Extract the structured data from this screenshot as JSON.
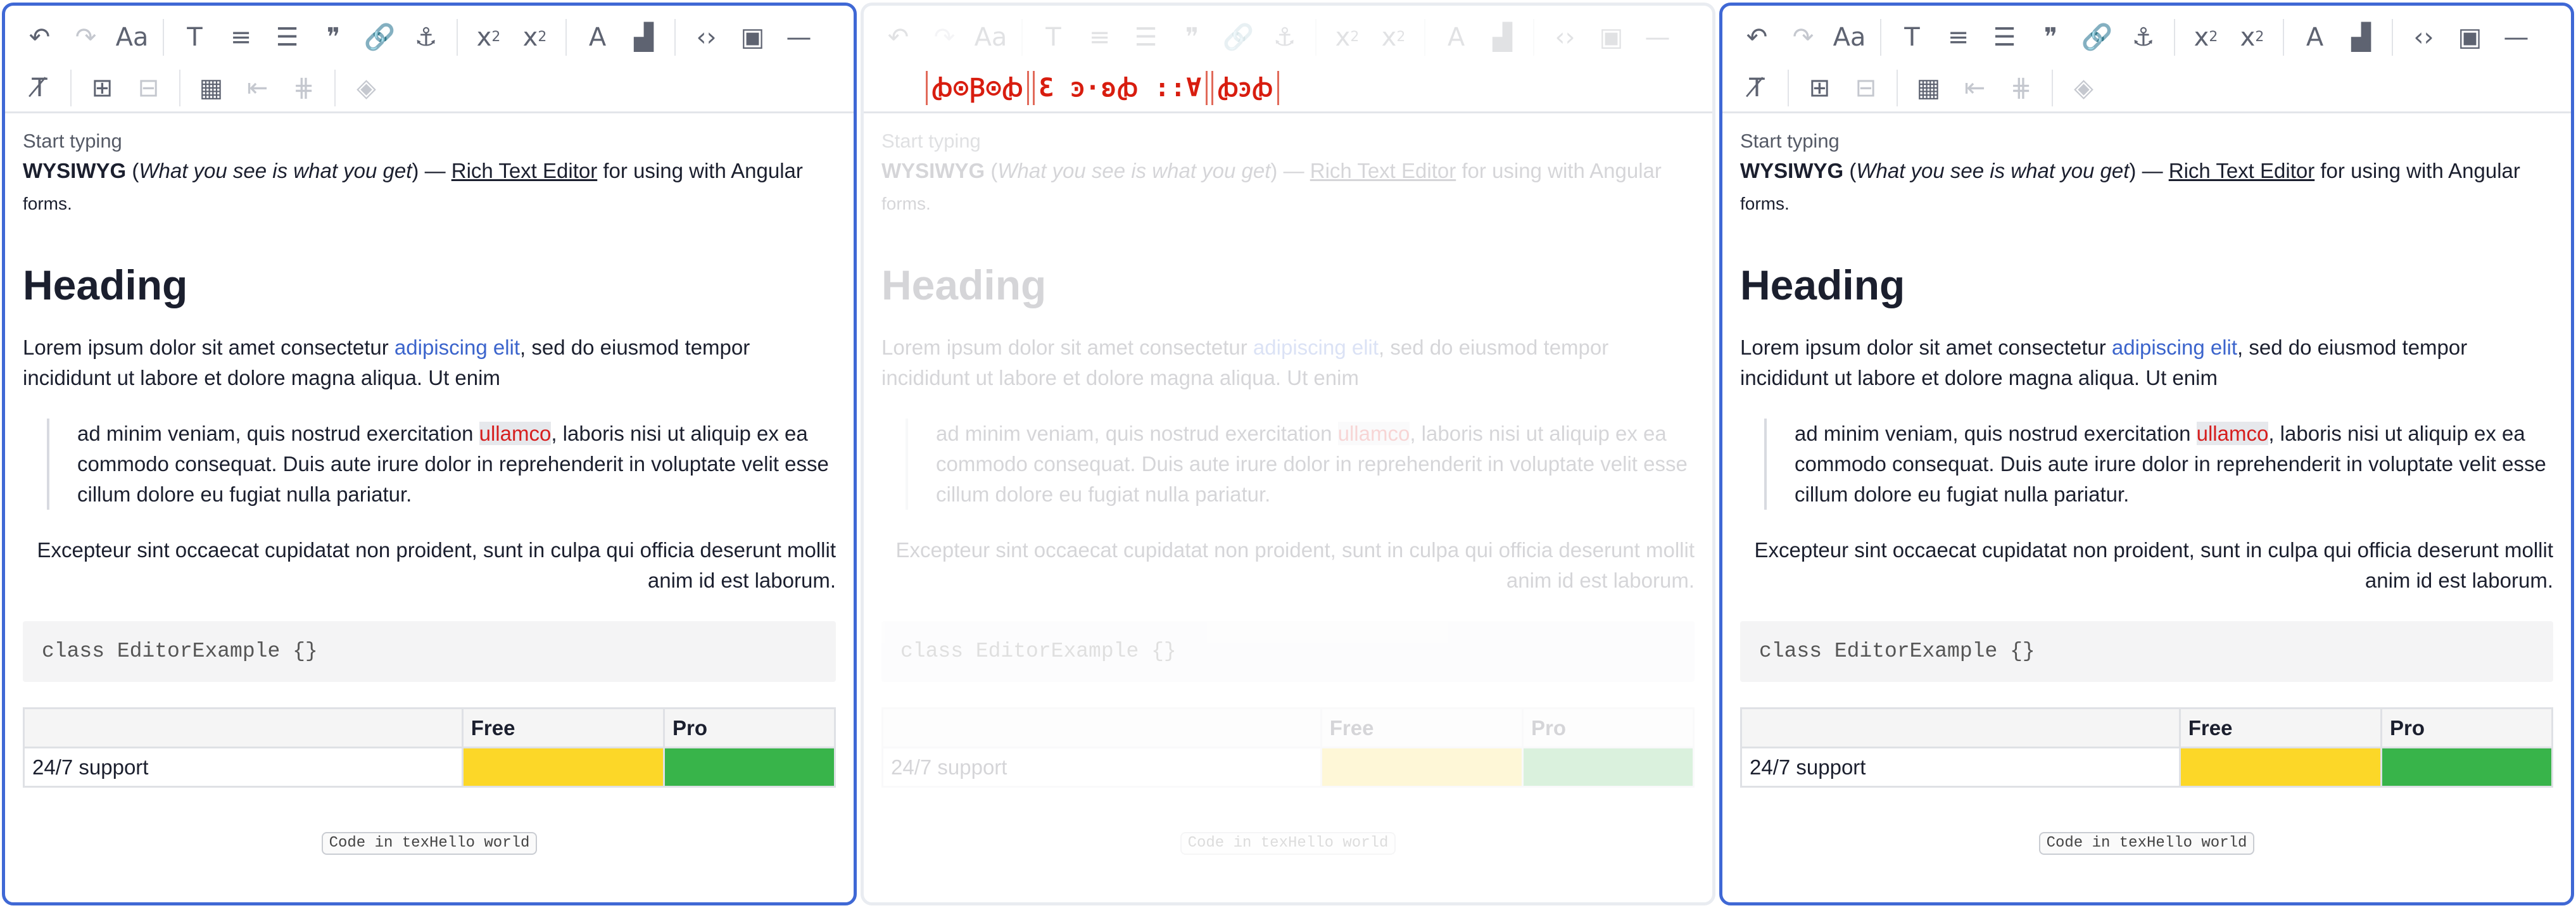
{
  "toolbar": {
    "row1": [
      {
        "name": "undo-icon",
        "glyph": "↶",
        "disabled": false
      },
      {
        "name": "redo-icon",
        "glyph": "↷",
        "disabled": true
      },
      {
        "name": "font-size-icon",
        "glyph": "Aa",
        "disabled": false
      },
      {
        "name": "sep"
      },
      {
        "name": "text-style-icon",
        "glyph": "T",
        "disabled": false
      },
      {
        "name": "align-icon",
        "glyph": "≡",
        "disabled": false
      },
      {
        "name": "list-icon",
        "glyph": "☰",
        "disabled": false
      },
      {
        "name": "quote-icon",
        "glyph": "❞",
        "disabled": false
      },
      {
        "name": "link-icon",
        "glyph": "🔗",
        "disabled": false
      },
      {
        "name": "anchor-icon",
        "glyph": "⚓",
        "disabled": false
      },
      {
        "name": "sep"
      },
      {
        "name": "subscript-icon",
        "glyph": "x₂",
        "disabled": false
      },
      {
        "name": "superscript-icon",
        "glyph": "x²",
        "disabled": false
      },
      {
        "name": "sep"
      },
      {
        "name": "text-color-icon",
        "glyph": "A",
        "disabled": false
      },
      {
        "name": "paint-roller-icon",
        "glyph": "▟",
        "disabled": false
      },
      {
        "name": "sep"
      },
      {
        "name": "code-icon",
        "glyph": "‹›",
        "disabled": false
      },
      {
        "name": "image-icon",
        "glyph": "▣",
        "disabled": false
      },
      {
        "name": "horizontal-rule-icon",
        "glyph": "—",
        "disabled": false
      }
    ],
    "row2": [
      {
        "name": "clear-format-icon",
        "glyph": "T̸",
        "disabled": false
      },
      {
        "name": "sep"
      },
      {
        "name": "add-row-icon",
        "glyph": "⊞",
        "disabled": false
      },
      {
        "name": "remove-row-icon",
        "glyph": "⊟",
        "disabled": true
      },
      {
        "name": "sep"
      },
      {
        "name": "table-icon",
        "glyph": "▦",
        "disabled": false
      },
      {
        "name": "indent-table-icon",
        "glyph": "⇤",
        "disabled": true
      },
      {
        "name": "merge-cells-icon",
        "glyph": "⋕",
        "disabled": true
      },
      {
        "name": "sep"
      },
      {
        "name": "cell-fill-icon",
        "glyph": "◈",
        "disabled": true
      }
    ]
  },
  "glitch": [
    "ꞗ⊙Ꞵ⊙ꞗ",
    "Ɛ ꜿ·ʚꞗ ꞉꞉Ɐ",
    "ꞗꜿꞗ"
  ],
  "editor": {
    "placeholder": "Start typing",
    "intro": {
      "bold": "WYSIWYG",
      "open": " (",
      "italic": "What you see is what you get",
      "close": ") — ",
      "link": "Rich Text Editor",
      "rest": " for using with Angular",
      "small": "forms."
    },
    "heading": "Heading",
    "para1": {
      "before": "Lorem ipsum dolor sit amet consectetur ",
      "link": "adipiscing elit",
      "after": ", sed do eiusmod tempor incididunt ut labore et dolore magna aliqua. Ut enim"
    },
    "quote": {
      "before": "ad minim veniam, quis nostrud exercitation ",
      "highlight": "ullamco",
      "after": ", laboris nisi ut aliquip ex ea commodo consequat. Duis aute irure dolor in reprehenderit in voluptate velit esse cillum dolore eu fugiat nulla pariatur."
    },
    "right": "Excepteur sint occaecat cupidatat non proident, sunt in culpa qui officia deserunt mollit anim id est laborum.",
    "code": "class EditorExample {}",
    "table": {
      "headers": [
        "",
        "Free",
        "Pro"
      ],
      "row_label": "24/7 support",
      "colors": {
        "free": "#fcd728",
        "pro": "#38b44a"
      }
    },
    "badge": "Code in texHello world"
  },
  "colors": {
    "accent": "#3f68d5",
    "link": "#3b64cc",
    "highlight": "#d61e1e"
  }
}
